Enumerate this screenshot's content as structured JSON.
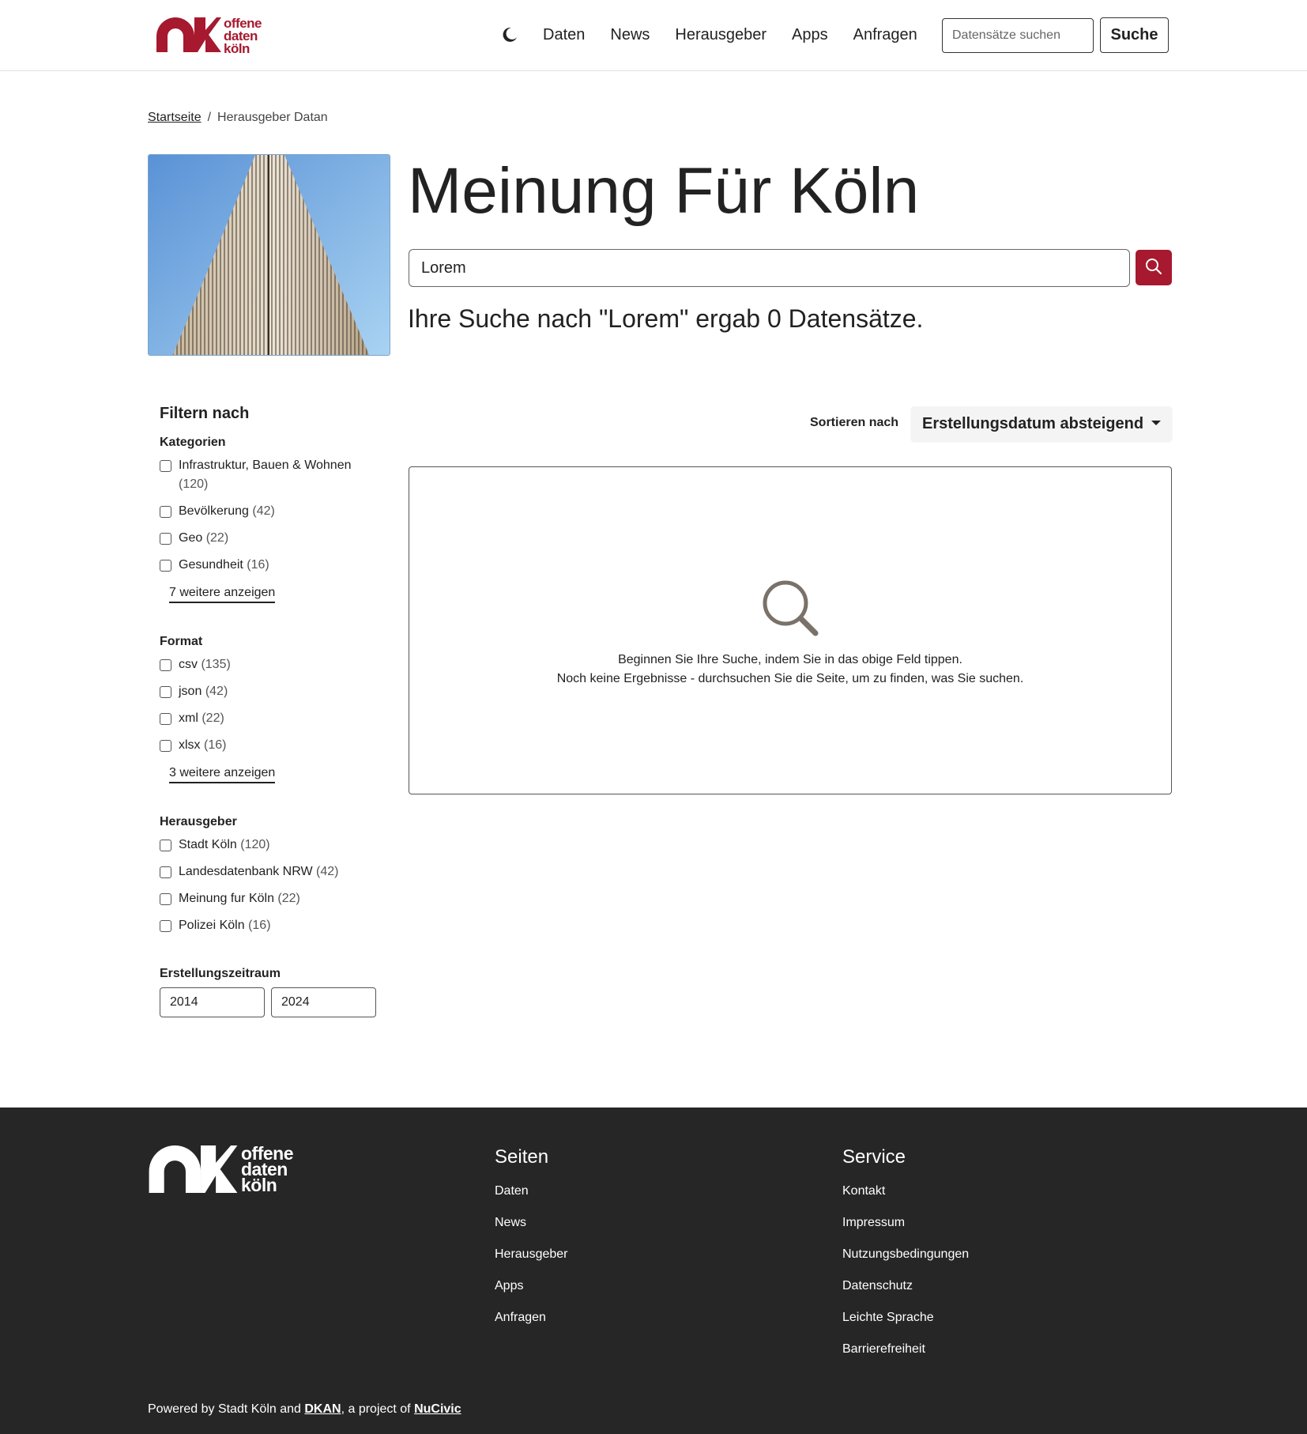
{
  "header": {
    "logo_lines": [
      "offene",
      "daten",
      "köln"
    ],
    "nav": [
      "Daten",
      "News",
      "Herausgeber",
      "Apps",
      "Anfragen"
    ],
    "search_placeholder": "Datensätze suchen",
    "search_button": "Suche"
  },
  "breadcrumb": {
    "home": "Startseite",
    "separator": "/",
    "current": "Herausgeber Datan"
  },
  "hero": {
    "title": "Meinung Für Köln",
    "search_value": "Lorem",
    "result_text": "Ihre Suche nach \"Lorem\" ergab 0 Datensätze."
  },
  "filters": {
    "title": "Filtern nach",
    "categories": {
      "title": "Kategorien",
      "items": [
        {
          "label": "Infrastruktur, Bauen & Wohnen",
          "count": "(120)"
        },
        {
          "label": "Bevölkerung",
          "count": "(42)"
        },
        {
          "label": "Geo",
          "count": "(22)"
        },
        {
          "label": "Gesundheit",
          "count": "(16)"
        }
      ],
      "more": "7 weitere anzeigen"
    },
    "format": {
      "title": "Format",
      "items": [
        {
          "label": "csv",
          "count": "(135)"
        },
        {
          "label": "json",
          "count": "(42)"
        },
        {
          "label": "xml",
          "count": "(22)"
        },
        {
          "label": "xlsx",
          "count": "(16)"
        }
      ],
      "more": "3 weitere anzeigen"
    },
    "publisher": {
      "title": "Herausgeber",
      "items": [
        {
          "label": "Stadt Köln",
          "count": "(120)"
        },
        {
          "label": "Landesdatenbank NRW",
          "count": "(42)"
        },
        {
          "label": "Meinung fur Köln",
          "count": "(22)"
        },
        {
          "label": "Polizei Köln",
          "count": "(16)"
        }
      ]
    },
    "period": {
      "title": "Erstellungszeitraum",
      "from": "2014",
      "to": "2024"
    }
  },
  "sort": {
    "label": "Sortieren nach",
    "value": "Erstellungsdatum absteigend"
  },
  "results": {
    "line1": "Beginnen Sie Ihre Suche, indem Sie in das obige Feld tippen.",
    "line2": "Noch keine Ergebnisse - durchsuchen Sie die Seite, um zu finden, was Sie suchen."
  },
  "footer": {
    "logo_lines": [
      "offene",
      "daten",
      "köln"
    ],
    "pages": {
      "title": "Seiten",
      "links": [
        "Daten",
        "News",
        "Herausgeber",
        "Apps",
        "Anfragen"
      ]
    },
    "service": {
      "title": "Service",
      "links": [
        "Kontakt",
        "Impressum",
        "Nutzungsbedingungen",
        "Datenschutz",
        "Leichte Sprache",
        "Barrierefreiheit"
      ]
    },
    "powered_prefix": "Powered by Stadt Köln and ",
    "dkan": "DKAN",
    "powered_middle": ", a project of ",
    "nucivic": "NuCivic"
  },
  "colors": {
    "brand": "#a6192e",
    "footer_bg": "#262626"
  },
  "icons": [
    "moon-icon",
    "search-icon",
    "chevron-down-icon",
    "magnifier-large-icon"
  ]
}
